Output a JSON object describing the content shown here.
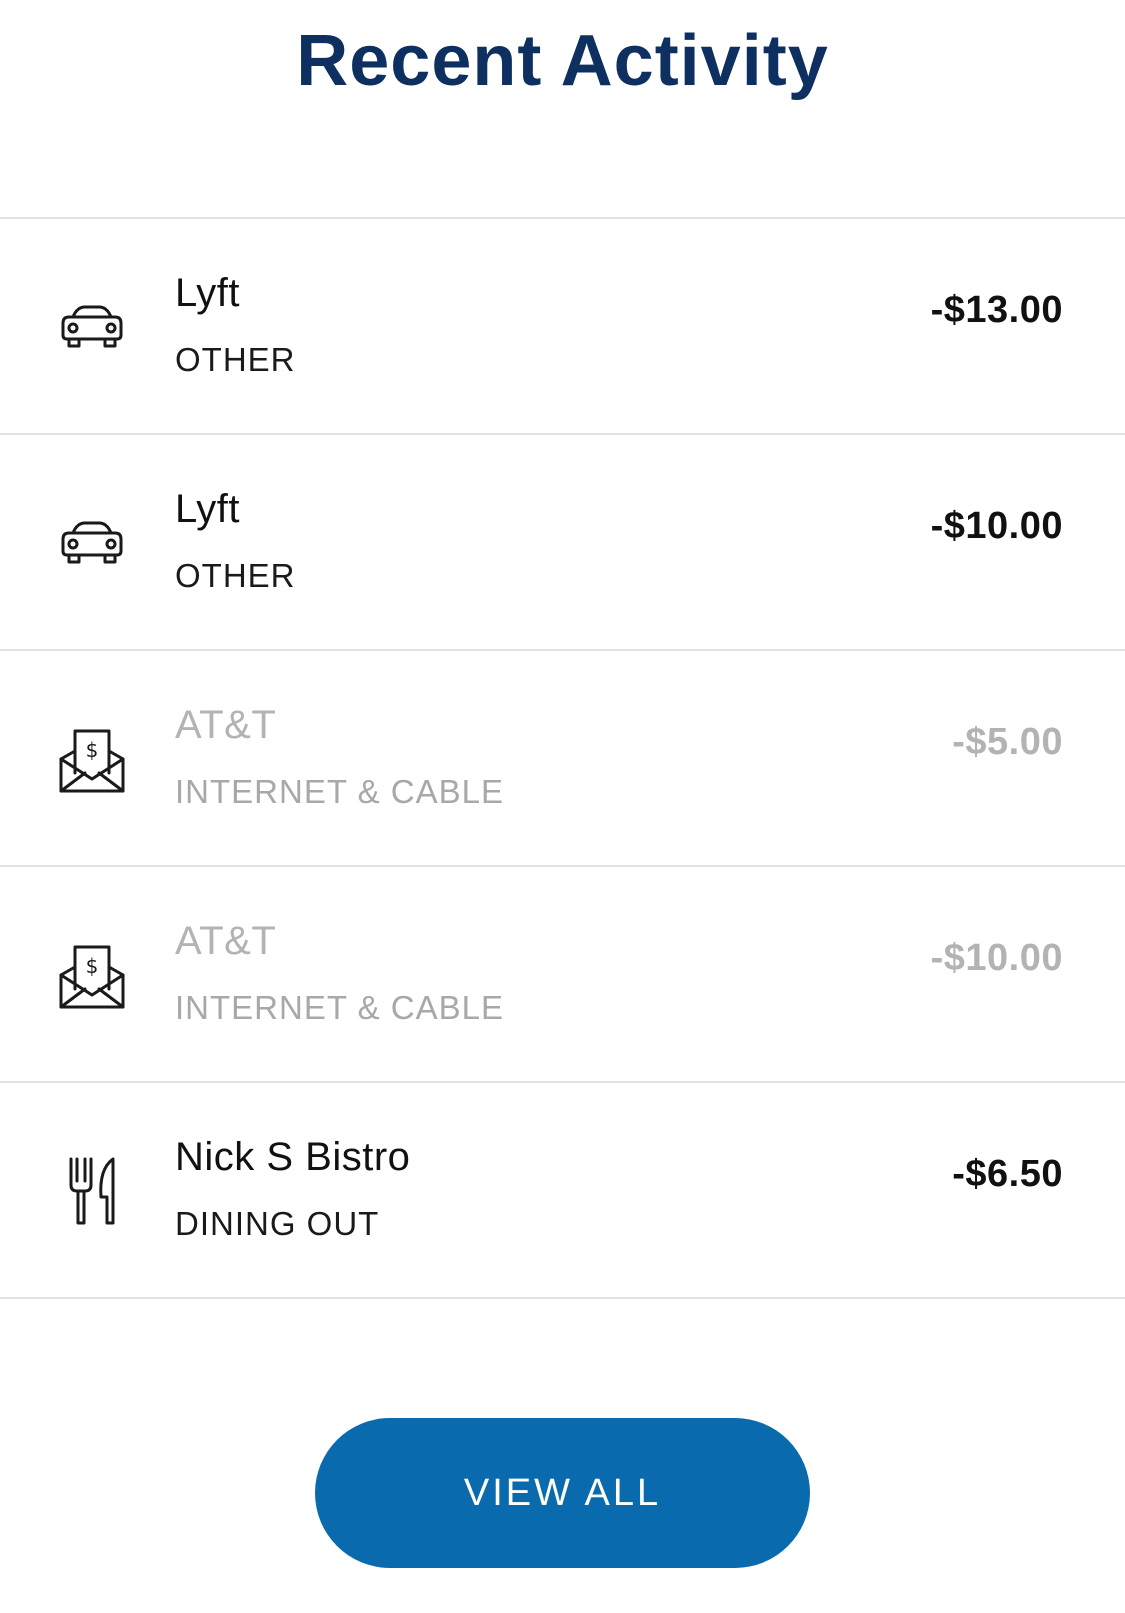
{
  "header": {
    "title": "Recent Activity"
  },
  "transactions": [
    {
      "merchant": "Lyft",
      "category": "OTHER",
      "amount": "-$13.00",
      "icon": "car-icon",
      "pending": false
    },
    {
      "merchant": "Lyft",
      "category": "OTHER",
      "amount": "-$10.00",
      "icon": "car-icon",
      "pending": false
    },
    {
      "merchant": "AT&T",
      "category": "INTERNET & CABLE",
      "amount": "-$5.00",
      "icon": "bill-envelope-icon",
      "pending": true
    },
    {
      "merchant": "AT&T",
      "category": "INTERNET & CABLE",
      "amount": "-$10.00",
      "icon": "bill-envelope-icon",
      "pending": true
    },
    {
      "merchant": "Nick S Bistro",
      "category": "DINING OUT",
      "amount": "-$6.50",
      "icon": "fork-knife-icon",
      "pending": false
    }
  ],
  "footer": {
    "view_all_label": "VIEW ALL"
  },
  "colors": {
    "title": "#0d3060",
    "button": "#0a6aae",
    "pending_text": "#b3b3b3",
    "divider": "#e3e3e3"
  }
}
